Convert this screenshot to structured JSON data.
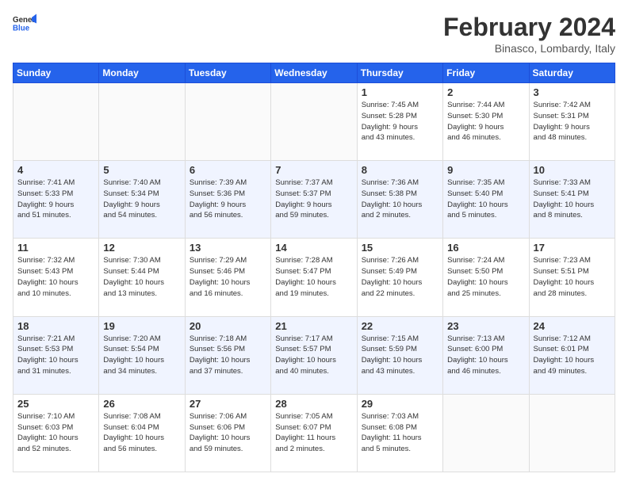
{
  "logo": {
    "line1": "General",
    "line2": "Blue"
  },
  "title": "February 2024",
  "location": "Binasco, Lombardy, Italy",
  "weekdays": [
    "Sunday",
    "Monday",
    "Tuesday",
    "Wednesday",
    "Thursday",
    "Friday",
    "Saturday"
  ],
  "weeks": [
    [
      {
        "day": "",
        "info": ""
      },
      {
        "day": "",
        "info": ""
      },
      {
        "day": "",
        "info": ""
      },
      {
        "day": "",
        "info": ""
      },
      {
        "day": "1",
        "info": "Sunrise: 7:45 AM\nSunset: 5:28 PM\nDaylight: 9 hours\nand 43 minutes."
      },
      {
        "day": "2",
        "info": "Sunrise: 7:44 AM\nSunset: 5:30 PM\nDaylight: 9 hours\nand 46 minutes."
      },
      {
        "day": "3",
        "info": "Sunrise: 7:42 AM\nSunset: 5:31 PM\nDaylight: 9 hours\nand 48 minutes."
      }
    ],
    [
      {
        "day": "4",
        "info": "Sunrise: 7:41 AM\nSunset: 5:33 PM\nDaylight: 9 hours\nand 51 minutes."
      },
      {
        "day": "5",
        "info": "Sunrise: 7:40 AM\nSunset: 5:34 PM\nDaylight: 9 hours\nand 54 minutes."
      },
      {
        "day": "6",
        "info": "Sunrise: 7:39 AM\nSunset: 5:36 PM\nDaylight: 9 hours\nand 56 minutes."
      },
      {
        "day": "7",
        "info": "Sunrise: 7:37 AM\nSunset: 5:37 PM\nDaylight: 9 hours\nand 59 minutes."
      },
      {
        "day": "8",
        "info": "Sunrise: 7:36 AM\nSunset: 5:38 PM\nDaylight: 10 hours\nand 2 minutes."
      },
      {
        "day": "9",
        "info": "Sunrise: 7:35 AM\nSunset: 5:40 PM\nDaylight: 10 hours\nand 5 minutes."
      },
      {
        "day": "10",
        "info": "Sunrise: 7:33 AM\nSunset: 5:41 PM\nDaylight: 10 hours\nand 8 minutes."
      }
    ],
    [
      {
        "day": "11",
        "info": "Sunrise: 7:32 AM\nSunset: 5:43 PM\nDaylight: 10 hours\nand 10 minutes."
      },
      {
        "day": "12",
        "info": "Sunrise: 7:30 AM\nSunset: 5:44 PM\nDaylight: 10 hours\nand 13 minutes."
      },
      {
        "day": "13",
        "info": "Sunrise: 7:29 AM\nSunset: 5:46 PM\nDaylight: 10 hours\nand 16 minutes."
      },
      {
        "day": "14",
        "info": "Sunrise: 7:28 AM\nSunset: 5:47 PM\nDaylight: 10 hours\nand 19 minutes."
      },
      {
        "day": "15",
        "info": "Sunrise: 7:26 AM\nSunset: 5:49 PM\nDaylight: 10 hours\nand 22 minutes."
      },
      {
        "day": "16",
        "info": "Sunrise: 7:24 AM\nSunset: 5:50 PM\nDaylight: 10 hours\nand 25 minutes."
      },
      {
        "day": "17",
        "info": "Sunrise: 7:23 AM\nSunset: 5:51 PM\nDaylight: 10 hours\nand 28 minutes."
      }
    ],
    [
      {
        "day": "18",
        "info": "Sunrise: 7:21 AM\nSunset: 5:53 PM\nDaylight: 10 hours\nand 31 minutes."
      },
      {
        "day": "19",
        "info": "Sunrise: 7:20 AM\nSunset: 5:54 PM\nDaylight: 10 hours\nand 34 minutes."
      },
      {
        "day": "20",
        "info": "Sunrise: 7:18 AM\nSunset: 5:56 PM\nDaylight: 10 hours\nand 37 minutes."
      },
      {
        "day": "21",
        "info": "Sunrise: 7:17 AM\nSunset: 5:57 PM\nDaylight: 10 hours\nand 40 minutes."
      },
      {
        "day": "22",
        "info": "Sunrise: 7:15 AM\nSunset: 5:59 PM\nDaylight: 10 hours\nand 43 minutes."
      },
      {
        "day": "23",
        "info": "Sunrise: 7:13 AM\nSunset: 6:00 PM\nDaylight: 10 hours\nand 46 minutes."
      },
      {
        "day": "24",
        "info": "Sunrise: 7:12 AM\nSunset: 6:01 PM\nDaylight: 10 hours\nand 49 minutes."
      }
    ],
    [
      {
        "day": "25",
        "info": "Sunrise: 7:10 AM\nSunset: 6:03 PM\nDaylight: 10 hours\nand 52 minutes."
      },
      {
        "day": "26",
        "info": "Sunrise: 7:08 AM\nSunset: 6:04 PM\nDaylight: 10 hours\nand 56 minutes."
      },
      {
        "day": "27",
        "info": "Sunrise: 7:06 AM\nSunset: 6:06 PM\nDaylight: 10 hours\nand 59 minutes."
      },
      {
        "day": "28",
        "info": "Sunrise: 7:05 AM\nSunset: 6:07 PM\nDaylight: 11 hours\nand 2 minutes."
      },
      {
        "day": "29",
        "info": "Sunrise: 7:03 AM\nSunset: 6:08 PM\nDaylight: 11 hours\nand 5 minutes."
      },
      {
        "day": "",
        "info": ""
      },
      {
        "day": "",
        "info": ""
      }
    ]
  ]
}
